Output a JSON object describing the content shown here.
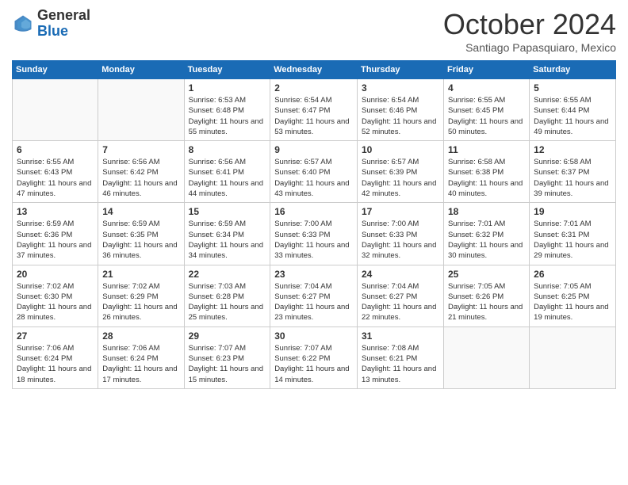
{
  "header": {
    "logo_general": "General",
    "logo_blue": "Blue",
    "month": "October 2024",
    "location": "Santiago Papasquiaro, Mexico"
  },
  "days_of_week": [
    "Sunday",
    "Monday",
    "Tuesday",
    "Wednesday",
    "Thursday",
    "Friday",
    "Saturday"
  ],
  "weeks": [
    [
      {
        "day": "",
        "empty": true
      },
      {
        "day": "",
        "empty": true
      },
      {
        "day": "1",
        "sunrise": "Sunrise: 6:53 AM",
        "sunset": "Sunset: 6:48 PM",
        "daylight": "Daylight: 11 hours and 55 minutes."
      },
      {
        "day": "2",
        "sunrise": "Sunrise: 6:54 AM",
        "sunset": "Sunset: 6:47 PM",
        "daylight": "Daylight: 11 hours and 53 minutes."
      },
      {
        "day": "3",
        "sunrise": "Sunrise: 6:54 AM",
        "sunset": "Sunset: 6:46 PM",
        "daylight": "Daylight: 11 hours and 52 minutes."
      },
      {
        "day": "4",
        "sunrise": "Sunrise: 6:55 AM",
        "sunset": "Sunset: 6:45 PM",
        "daylight": "Daylight: 11 hours and 50 minutes."
      },
      {
        "day": "5",
        "sunrise": "Sunrise: 6:55 AM",
        "sunset": "Sunset: 6:44 PM",
        "daylight": "Daylight: 11 hours and 49 minutes."
      }
    ],
    [
      {
        "day": "6",
        "sunrise": "Sunrise: 6:55 AM",
        "sunset": "Sunset: 6:43 PM",
        "daylight": "Daylight: 11 hours and 47 minutes."
      },
      {
        "day": "7",
        "sunrise": "Sunrise: 6:56 AM",
        "sunset": "Sunset: 6:42 PM",
        "daylight": "Daylight: 11 hours and 46 minutes."
      },
      {
        "day": "8",
        "sunrise": "Sunrise: 6:56 AM",
        "sunset": "Sunset: 6:41 PM",
        "daylight": "Daylight: 11 hours and 44 minutes."
      },
      {
        "day": "9",
        "sunrise": "Sunrise: 6:57 AM",
        "sunset": "Sunset: 6:40 PM",
        "daylight": "Daylight: 11 hours and 43 minutes."
      },
      {
        "day": "10",
        "sunrise": "Sunrise: 6:57 AM",
        "sunset": "Sunset: 6:39 PM",
        "daylight": "Daylight: 11 hours and 42 minutes."
      },
      {
        "day": "11",
        "sunrise": "Sunrise: 6:58 AM",
        "sunset": "Sunset: 6:38 PM",
        "daylight": "Daylight: 11 hours and 40 minutes."
      },
      {
        "day": "12",
        "sunrise": "Sunrise: 6:58 AM",
        "sunset": "Sunset: 6:37 PM",
        "daylight": "Daylight: 11 hours and 39 minutes."
      }
    ],
    [
      {
        "day": "13",
        "sunrise": "Sunrise: 6:59 AM",
        "sunset": "Sunset: 6:36 PM",
        "daylight": "Daylight: 11 hours and 37 minutes."
      },
      {
        "day": "14",
        "sunrise": "Sunrise: 6:59 AM",
        "sunset": "Sunset: 6:35 PM",
        "daylight": "Daylight: 11 hours and 36 minutes."
      },
      {
        "day": "15",
        "sunrise": "Sunrise: 6:59 AM",
        "sunset": "Sunset: 6:34 PM",
        "daylight": "Daylight: 11 hours and 34 minutes."
      },
      {
        "day": "16",
        "sunrise": "Sunrise: 7:00 AM",
        "sunset": "Sunset: 6:33 PM",
        "daylight": "Daylight: 11 hours and 33 minutes."
      },
      {
        "day": "17",
        "sunrise": "Sunrise: 7:00 AM",
        "sunset": "Sunset: 6:33 PM",
        "daylight": "Daylight: 11 hours and 32 minutes."
      },
      {
        "day": "18",
        "sunrise": "Sunrise: 7:01 AM",
        "sunset": "Sunset: 6:32 PM",
        "daylight": "Daylight: 11 hours and 30 minutes."
      },
      {
        "day": "19",
        "sunrise": "Sunrise: 7:01 AM",
        "sunset": "Sunset: 6:31 PM",
        "daylight": "Daylight: 11 hours and 29 minutes."
      }
    ],
    [
      {
        "day": "20",
        "sunrise": "Sunrise: 7:02 AM",
        "sunset": "Sunset: 6:30 PM",
        "daylight": "Daylight: 11 hours and 28 minutes."
      },
      {
        "day": "21",
        "sunrise": "Sunrise: 7:02 AM",
        "sunset": "Sunset: 6:29 PM",
        "daylight": "Daylight: 11 hours and 26 minutes."
      },
      {
        "day": "22",
        "sunrise": "Sunrise: 7:03 AM",
        "sunset": "Sunset: 6:28 PM",
        "daylight": "Daylight: 11 hours and 25 minutes."
      },
      {
        "day": "23",
        "sunrise": "Sunrise: 7:04 AM",
        "sunset": "Sunset: 6:27 PM",
        "daylight": "Daylight: 11 hours and 23 minutes."
      },
      {
        "day": "24",
        "sunrise": "Sunrise: 7:04 AM",
        "sunset": "Sunset: 6:27 PM",
        "daylight": "Daylight: 11 hours and 22 minutes."
      },
      {
        "day": "25",
        "sunrise": "Sunrise: 7:05 AM",
        "sunset": "Sunset: 6:26 PM",
        "daylight": "Daylight: 11 hours and 21 minutes."
      },
      {
        "day": "26",
        "sunrise": "Sunrise: 7:05 AM",
        "sunset": "Sunset: 6:25 PM",
        "daylight": "Daylight: 11 hours and 19 minutes."
      }
    ],
    [
      {
        "day": "27",
        "sunrise": "Sunrise: 7:06 AM",
        "sunset": "Sunset: 6:24 PM",
        "daylight": "Daylight: 11 hours and 18 minutes."
      },
      {
        "day": "28",
        "sunrise": "Sunrise: 7:06 AM",
        "sunset": "Sunset: 6:24 PM",
        "daylight": "Daylight: 11 hours and 17 minutes."
      },
      {
        "day": "29",
        "sunrise": "Sunrise: 7:07 AM",
        "sunset": "Sunset: 6:23 PM",
        "daylight": "Daylight: 11 hours and 15 minutes."
      },
      {
        "day": "30",
        "sunrise": "Sunrise: 7:07 AM",
        "sunset": "Sunset: 6:22 PM",
        "daylight": "Daylight: 11 hours and 14 minutes."
      },
      {
        "day": "31",
        "sunrise": "Sunrise: 7:08 AM",
        "sunset": "Sunset: 6:21 PM",
        "daylight": "Daylight: 11 hours and 13 minutes."
      },
      {
        "day": "",
        "empty": true
      },
      {
        "day": "",
        "empty": true
      }
    ]
  ]
}
